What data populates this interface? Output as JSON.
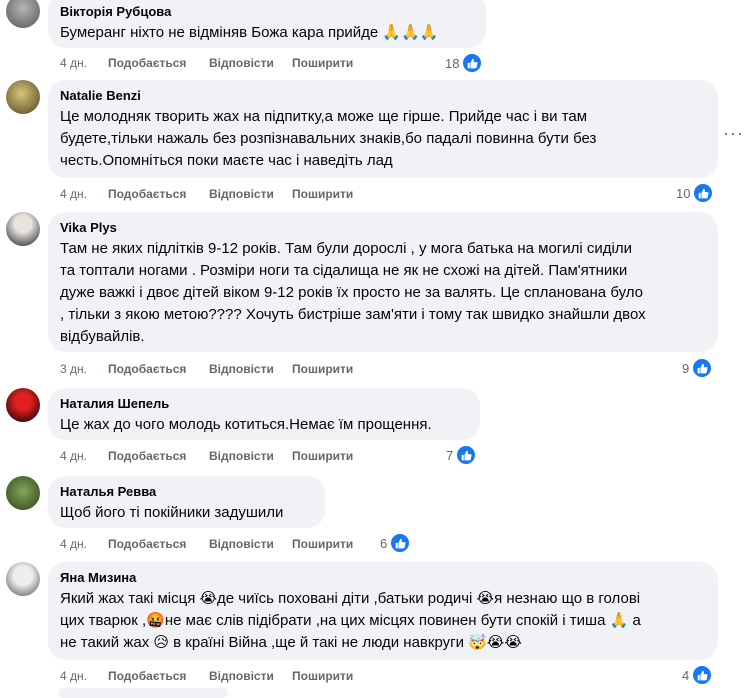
{
  "comments": [
    {
      "author": "Вікторія Рубцова",
      "text_lines": [
        "Бумеранг ніхто не відміняв Божа кара прийде 🙏🙏🙏"
      ],
      "time": "4 дн.",
      "like": "Подобається",
      "reply": "Відповісти",
      "share": "Поширити",
      "reactions": "18",
      "avatar_colors": [
        "#9a9a9a",
        "#5a5a5a"
      ]
    },
    {
      "author": "Natalie Benzi",
      "text_lines": [
        "Це молодняк творить жах на підпитку,а може ще гірше. Прийде час і ви там",
        "будете,тільки нажаль без розпізнавальних знаків,бо падалі повинна бути без",
        "честь.Опомніться поки маєте час і наведіть лад"
      ],
      "time": "4 дн.",
      "like": "Подобається",
      "reply": "Відповісти",
      "share": "Поширити",
      "reactions": "10",
      "avatar_colors": [
        "#c9b96a",
        "#5b4a2a"
      ]
    },
    {
      "author": "Vika Plys",
      "text_lines": [
        "Там не яких підлітків 9-12 років. Там були дорослі , у мога батька на могилі сиділи",
        "та топтали ногами . Розміри ноги та сідалища не як не схожі на дітей. Пам'ятники",
        "дуже важкі і двоє дітей віком 9-12 років їх просто не за валять. Це спланована було",
        ", тільки з якою метою???? Хочуть бистріше зам'яти і тому так швидко знайшли двох",
        "відбувайлів."
      ],
      "time": "3 дн.",
      "like": "Подобається",
      "reply": "Відповісти",
      "share": "Поширити",
      "reactions": "9",
      "avatar_colors": [
        "#d8d4cf",
        "#4a4a4a"
      ]
    },
    {
      "author": "Наталия Шепель",
      "text_lines": [
        "Це жах до чого молодь котиться.Немає їм прощення."
      ],
      "time": "4 дн.",
      "like": "Подобається",
      "reply": "Відповісти",
      "share": "Поширити",
      "reactions": "7",
      "avatar_colors": [
        "#c81414",
        "#3a0a0a"
      ]
    },
    {
      "author": "Наталья Ревва",
      "text_lines": [
        "Щоб його ті покійники задушили"
      ],
      "time": "4 дн.",
      "like": "Подобається",
      "reply": "Відповісти",
      "share": "Поширити",
      "reactions": "6",
      "avatar_colors": [
        "#5f8a3a",
        "#2c4a1c"
      ]
    },
    {
      "author": "Яна Мизина",
      "text_lines": [
        "Який жах такі місця 😭де чиїсь поховані діти ,батьки родичі 😭я незнаю що в голові",
        "цих тварюк ,🤬не має слів підібрати ,на цих місцях повинен бути спокій і тиша 🙏 а",
        "не такий жах 😥 в країні Війна ,ще й такі не люди навкруги 🤯😭😭"
      ],
      "time": "4 дн.",
      "like": "Подобається",
      "reply": "Відповісти",
      "share": "Поширити",
      "reactions": "4",
      "avatar_colors": [
        "#d9d9d9",
        "#6a6a6a"
      ]
    }
  ],
  "more_icon": "more-options-icon",
  "like_icon": "thumbs-up-icon",
  "accent": "#1877f2"
}
